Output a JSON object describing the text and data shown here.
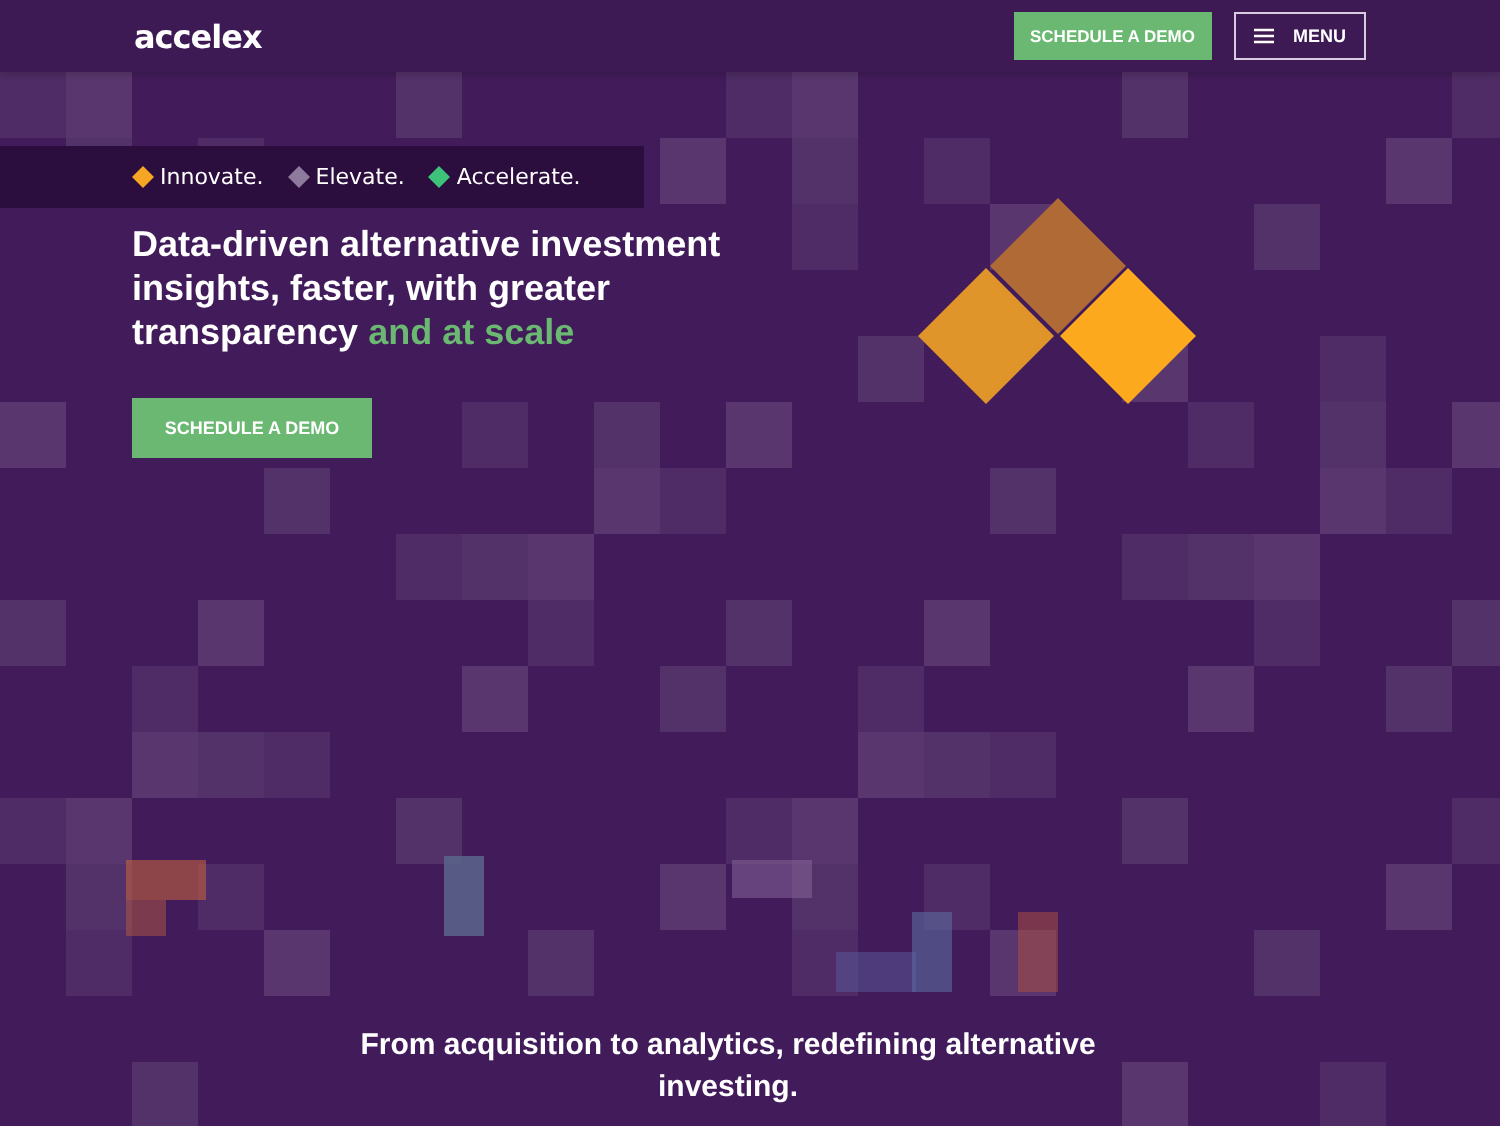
{
  "header": {
    "logo": "accelex",
    "cta": "SCHEDULE A DEMO",
    "menu": "MENU"
  },
  "taglines": [
    {
      "label": "Innovate.",
      "color": "#f5a623"
    },
    {
      "label": "Elevate.",
      "color": "#8e7a9c"
    },
    {
      "label": "Accelerate.",
      "color": "#3ec27a"
    }
  ],
  "hero": {
    "heading": "Data-driven alternative investment insights, faster, with greater transparency",
    "highlight": "and at scale",
    "cta": "SCHEDULE A DEMO"
  },
  "footer_text": "From acquisition to analytics, redefining alternative investing."
}
